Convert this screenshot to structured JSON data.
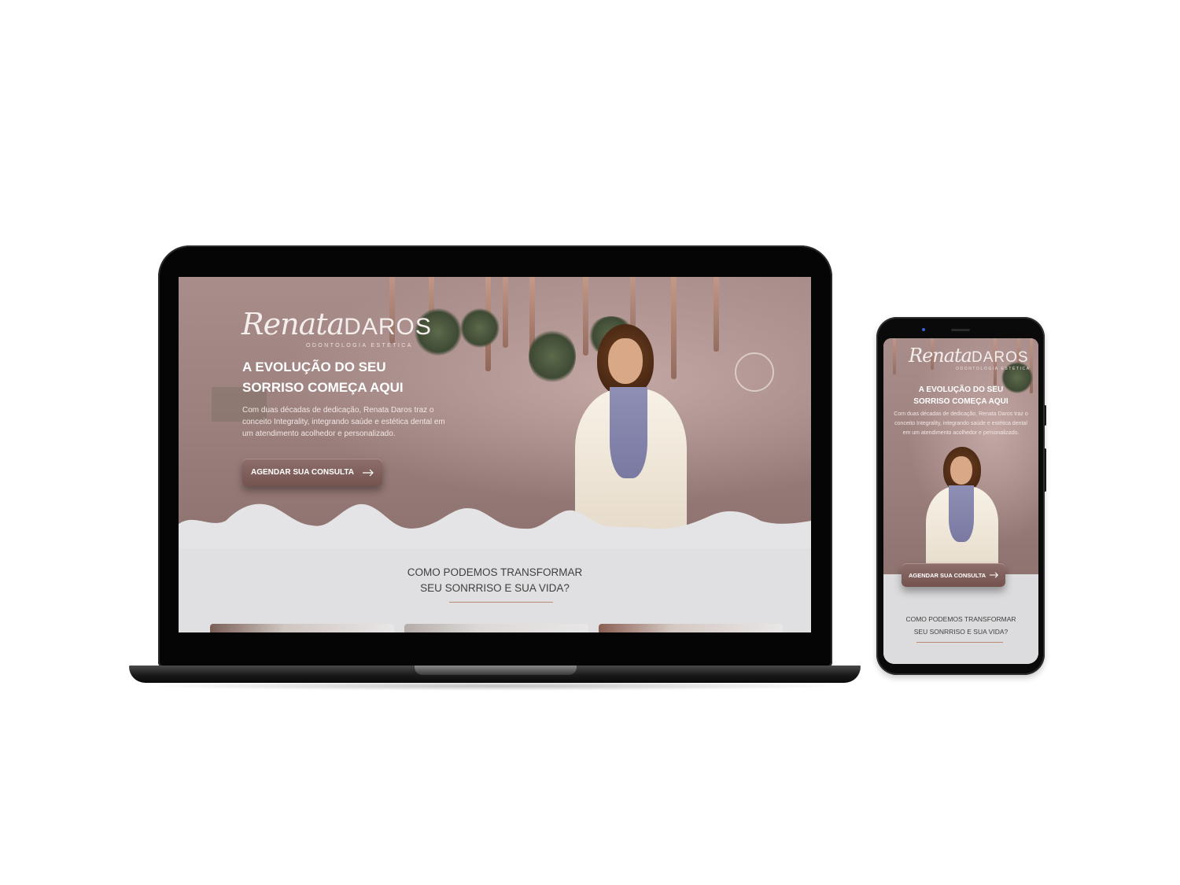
{
  "brand": {
    "script": "Renata",
    "caps": "DAROS",
    "tagline": "ODONTOLOGIA ESTÉTICA"
  },
  "hero": {
    "headline_line1": "A EVOLUÇÃO DO SEU",
    "headline_line2": "SORRISO COMEÇA AQUI",
    "description_line1": "Com duas décadas de dedicação, Renata Daros traz o",
    "description_line2": "conceito Integrality, integrando saúde e estética dental em",
    "description_line3": "um atendimento acolhedor e personalizado.",
    "mobile_description_line1": "Com duas décadas de dedicação, Renata Daros traz o",
    "mobile_description_line2": "conceito Integrality, integrando saúde e estética dental",
    "mobile_description_line3": "em um atendimento acolhedor e personalizado.",
    "cta_label": "AGENDAR SUA CONSULTA",
    "cta_icon": "arrow-right-icon"
  },
  "services": {
    "title_line1": "COMO PODEMOS TRANSFORMAR",
    "title_line2": "SEU SONRRISO E SUA VIDA?"
  },
  "colors": {
    "hero_bg": "#9c807e",
    "button": "#7e5f5b",
    "section_bg": "#dcdcde",
    "divider": "#b98b73"
  }
}
